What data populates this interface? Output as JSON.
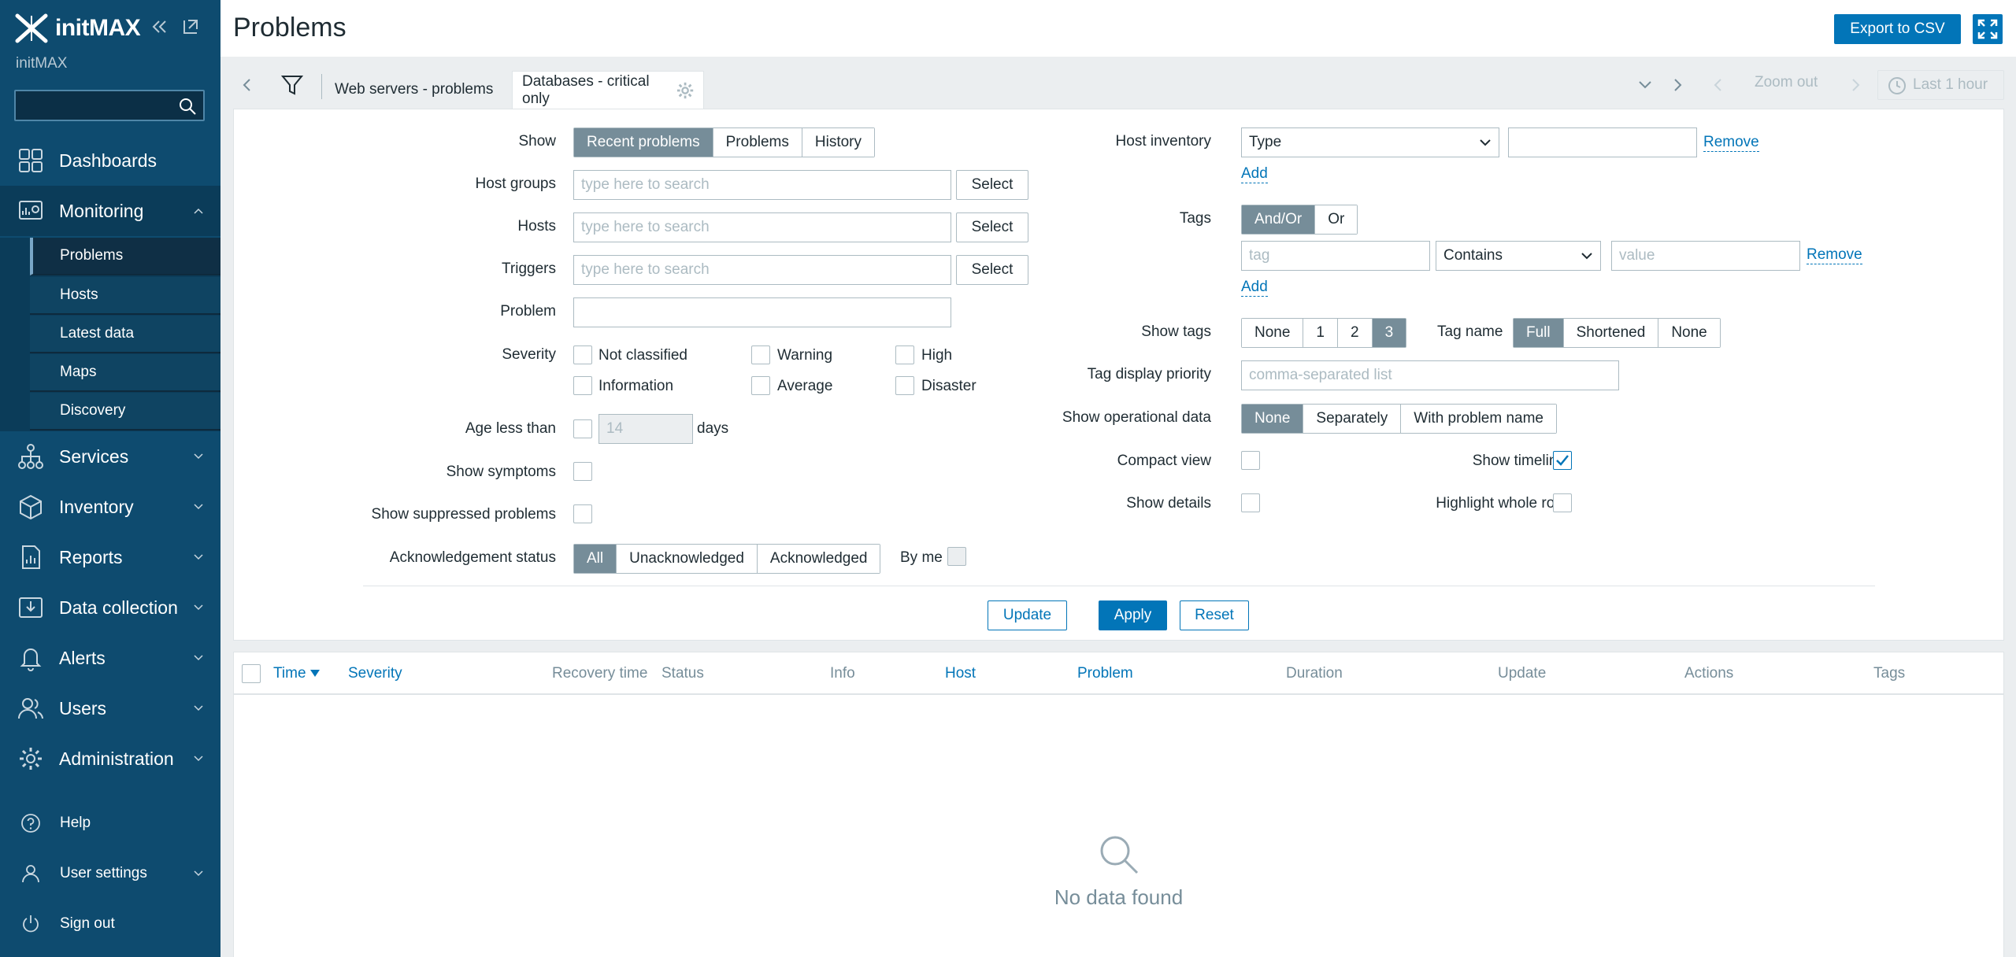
{
  "sidebar": {
    "brand": "initMAX",
    "server_name": "initMAX",
    "search_value": "",
    "menu": [
      {
        "label": "Dashboards",
        "icon": "dashboards-icon"
      },
      {
        "label": "Monitoring",
        "icon": "monitoring-icon",
        "expanded": true
      },
      {
        "label": "Services",
        "icon": "services-icon"
      },
      {
        "label": "Inventory",
        "icon": "inventory-icon"
      },
      {
        "label": "Reports",
        "icon": "reports-icon"
      },
      {
        "label": "Data collection",
        "icon": "data-collection-icon"
      },
      {
        "label": "Alerts",
        "icon": "alerts-icon"
      },
      {
        "label": "Users",
        "icon": "users-icon"
      },
      {
        "label": "Administration",
        "icon": "administration-icon"
      }
    ],
    "monitoring_items": [
      "Problems",
      "Hosts",
      "Latest data",
      "Maps",
      "Discovery"
    ],
    "footer": {
      "help": "Help",
      "user_settings": "User settings",
      "sign_out": "Sign out"
    }
  },
  "header": {
    "title": "Problems",
    "export_label": "Export to CSV"
  },
  "tabs": {
    "items": [
      "Web servers - problems",
      "Databases - critical only"
    ],
    "zoom_out": "Zoom out",
    "last_hour": "Last 1 hour"
  },
  "filter": {
    "show_label": "Show",
    "show_options": [
      "Recent problems",
      "Problems",
      "History"
    ],
    "host_groups_label": "Host groups",
    "hosts_label": "Hosts",
    "triggers_label": "Triggers",
    "search_placeholder": "type here to search",
    "select_label": "Select",
    "problem_label": "Problem",
    "severity_label": "Severity",
    "severities": [
      "Not classified",
      "Warning",
      "High",
      "Information",
      "Average",
      "Disaster"
    ],
    "age_label": "Age less than",
    "age_value": "14",
    "age_unit": "days",
    "show_symptoms_label": "Show symptoms",
    "show_suppressed_label": "Show suppressed problems",
    "ack_label": "Acknowledgement status",
    "ack_options": [
      "All",
      "Unacknowledged",
      "Acknowledged"
    ],
    "by_me_label": "By me",
    "host_inventory_label": "Host inventory",
    "inventory_type": "Type",
    "remove_label": "Remove",
    "add_label": "Add",
    "tags_label": "Tags",
    "tags_options": [
      "And/Or",
      "Or"
    ],
    "tag_placeholder": "tag",
    "tag_operator": "Contains",
    "value_placeholder": "value",
    "show_tags_label": "Show tags",
    "show_tags_options": [
      "None",
      "1",
      "2",
      "3"
    ],
    "tag_name_label": "Tag name",
    "tag_name_options": [
      "Full",
      "Shortened",
      "None"
    ],
    "tag_priority_label": "Tag display priority",
    "tag_priority_placeholder": "comma-separated list",
    "opdata_label": "Show operational data",
    "opdata_options": [
      "None",
      "Separately",
      "With problem name"
    ],
    "compact_view_label": "Compact view",
    "show_timeline_label": "Show timeline",
    "show_details_label": "Show details",
    "highlight_row_label": "Highlight whole row",
    "update_label": "Update",
    "apply_label": "Apply",
    "reset_label": "Reset"
  },
  "table": {
    "columns": [
      "Time",
      "Severity",
      "Recovery time",
      "Status",
      "Info",
      "Host",
      "Problem",
      "Duration",
      "Update",
      "Actions",
      "Tags"
    ],
    "empty_text": "No data found"
  },
  "colors": {
    "sidebar_bg": "#0e4b6f",
    "primary": "#0275b8",
    "segment_on": "#768d99"
  }
}
